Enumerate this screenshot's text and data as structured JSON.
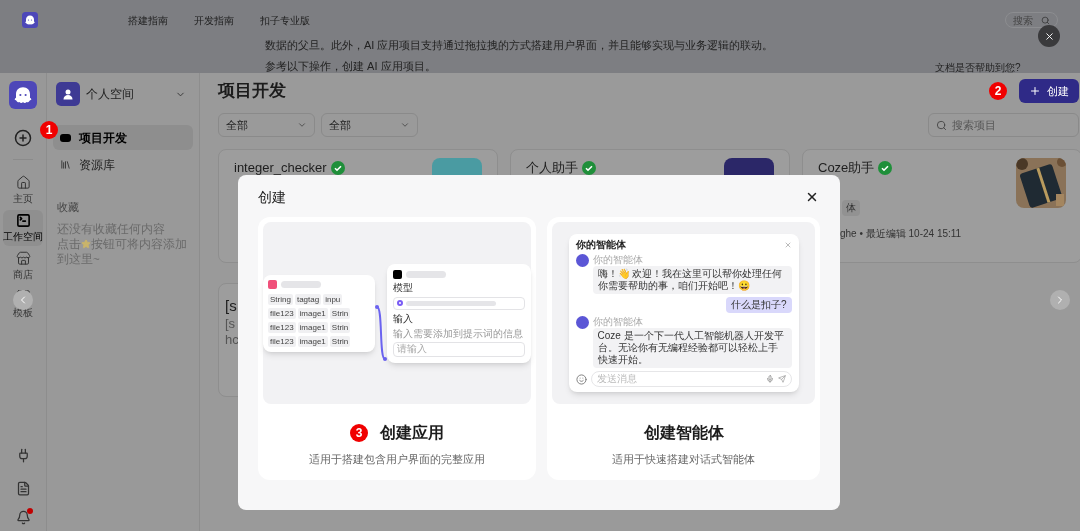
{
  "doc_header": {
    "nav": [
      "搭建指南",
      "开发指南",
      "扣子专业版"
    ],
    "search": {
      "placeholder": "搜索"
    },
    "paragraphs": [
      "数据的父旦。此外，AI 应用项目支持通过拖拉拽的方式搭建用户界面，并且能够实现与业务逻辑的联动。",
      "参考以下操作，创建 AI 应用项目。"
    ],
    "feedback": "文档是否帮助到您?"
  },
  "rail": {
    "items": [
      {
        "label": "主页",
        "selected": false
      },
      {
        "label": "工作空间",
        "selected": true
      },
      {
        "label": "商店",
        "selected": false
      },
      {
        "label": "模板",
        "selected": false
      }
    ],
    "notification_dot": true
  },
  "sidebar": {
    "space": "个人空间",
    "items": [
      {
        "label": "项目开发",
        "selected": true,
        "step": "1"
      },
      {
        "label": "资源库",
        "selected": false
      }
    ],
    "favorites_title": "收藏",
    "favorites_empty": [
      "还没有收藏任何内容",
      "点击",
      "按钮可将内容添加到这里~"
    ]
  },
  "main": {
    "title": "项目开发",
    "filters": [
      "全部",
      "全部"
    ],
    "search": {
      "placeholder": "搜索项目"
    },
    "create_button": {
      "label": "创建",
      "step": "2"
    },
    "cards": [
      {
        "title": "integer_checker",
        "verified": true
      },
      {
        "title": "个人助手",
        "verified": true
      },
      {
        "title": "Coze助手",
        "verified": true,
        "kind": "picture",
        "tag": "体",
        "meta": "ghe • 最近编辑 10-24 15:11"
      }
    ],
    "partial_card": {
      "lines": [
        "[s",
        "[s",
        "hc"
      ]
    }
  },
  "modal": {
    "title": "创建",
    "options": [
      {
        "kind": "app",
        "title": "创建应用",
        "description": "适用于搭建包含用户界面的完整应用",
        "step": "3",
        "preview": {
          "tags": [
            [
              "String",
              "tagtag",
              "inpu"
            ],
            [
              "file123",
              "image1",
              "Strin"
            ],
            [
              "file123",
              "image1",
              "Strin"
            ],
            [
              "file123",
              "image1",
              "Strin"
            ]
          ],
          "model_label": "模型",
          "input_label": "输入",
          "input_hint": "输入需要添加到提示词的信息",
          "input_placeholder": "请输入"
        }
      },
      {
        "kind": "agent",
        "title": "创建智能体",
        "description": "适用于快速搭建对话式智能体",
        "preview": {
          "title": "你的智能体",
          "messages": [
            {
              "kind": "bot",
              "name": "你的智能体",
              "text": "嗨！👋 欢迎！我在这里可以帮你处理任何你需要帮助的事，咱们开始吧！😀"
            },
            {
              "kind": "user",
              "text": "什么是扣子?"
            },
            {
              "kind": "bot",
              "name": "你的智能体",
              "text": "Coze 是一个下一代人工智能机器人开发平台。无论你有无编程经验都可以轻松上手快速开始。"
            }
          ],
          "input_placeholder": "发送消息"
        }
      }
    ]
  }
}
